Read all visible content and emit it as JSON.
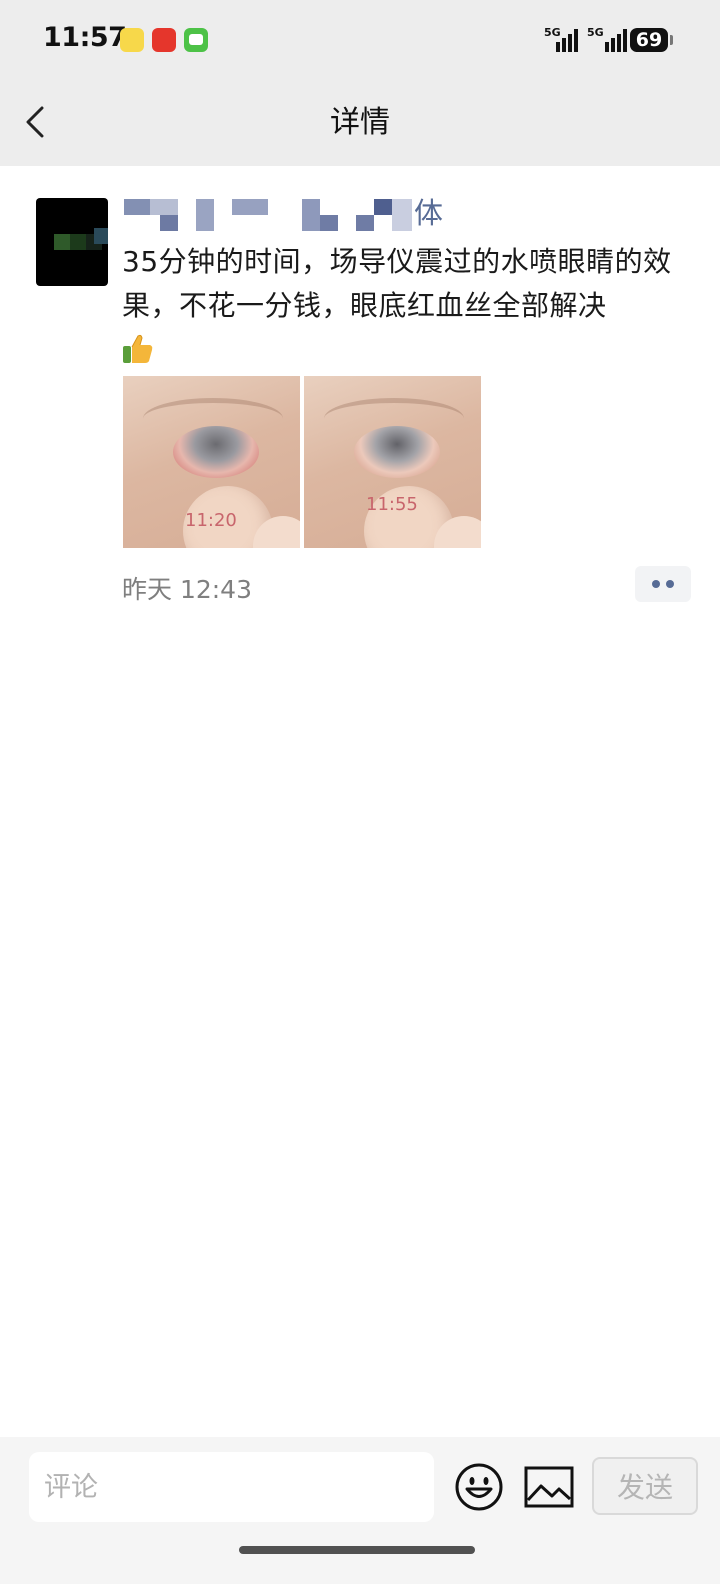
{
  "status_bar": {
    "time": "11:57",
    "network_1": "5G",
    "network_2": "5G",
    "battery": "69"
  },
  "nav": {
    "title": "详情"
  },
  "post": {
    "author_visible_text": "体",
    "text": "35分钟的时间，场导仪震过的水喷眼睛的效果，不花一分钱，眼底红血丝全部解决",
    "images": [
      {
        "stamp": "11:20"
      },
      {
        "stamp": "11:55"
      }
    ],
    "timestamp": "昨天 12:43"
  },
  "comment_bar": {
    "placeholder": "评论",
    "send_label": "发送"
  },
  "colors": {
    "link_blue": "#576b95",
    "bar_gray": "#ededed"
  }
}
